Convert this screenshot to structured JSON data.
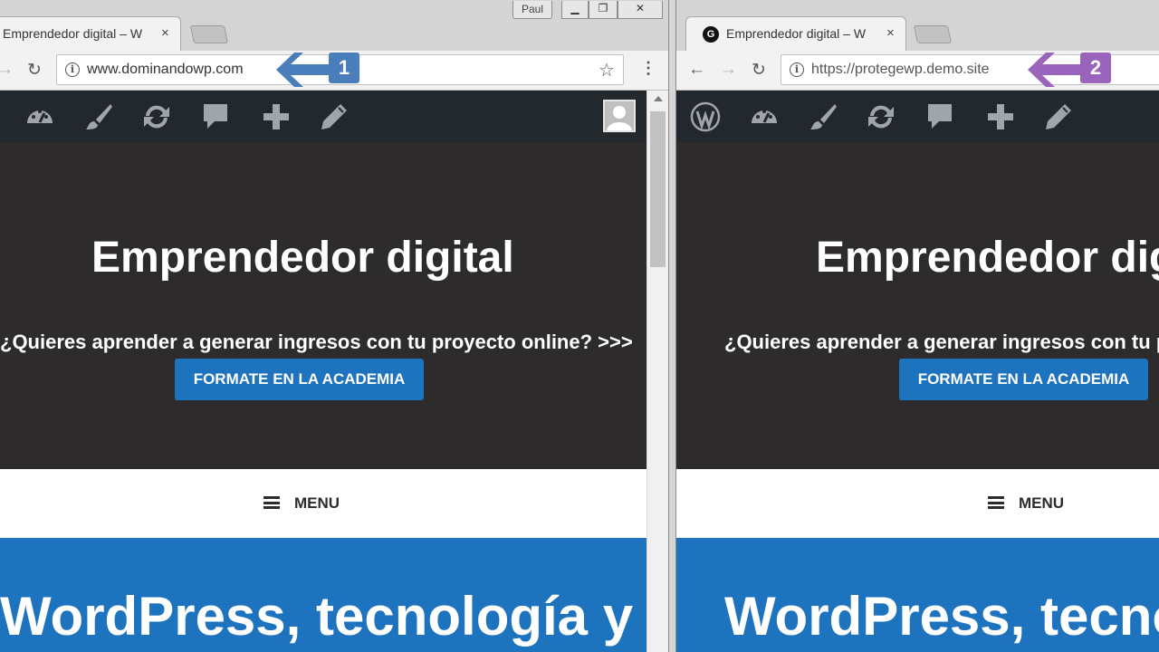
{
  "left_window": {
    "tab_title": "Emprendedor digital – W",
    "tab_close": "×",
    "user_badge": "Paul",
    "url": "www.dominandowp.com",
    "callout_number": "1",
    "callout_color": "#4a7ebb"
  },
  "right_window": {
    "tab_title": "Emprendedor digital – W",
    "tab_close": "×",
    "favicon_letter": "G",
    "url": "https://protegewp.demo.site",
    "callout_number": "2",
    "callout_color": "#9a63bc"
  },
  "icons": {
    "back": "←",
    "forward": "→",
    "reload": "↻",
    "info": "i",
    "star": "☆",
    "menu": "⋮"
  },
  "site": {
    "title": "Emprendedor digital",
    "tagline": "¿Quieres aprender a generar ingresos con tu proyecto online? >>>",
    "cta_button": "FORMATE EN LA ACADEMIA",
    "menu_label": "MENU",
    "headline": "WordPress, tecnología y"
  },
  "colors": {
    "admin_bar": "#23282d",
    "hero_bg": "#2d2b2b",
    "accent_blue": "#1e73be"
  }
}
